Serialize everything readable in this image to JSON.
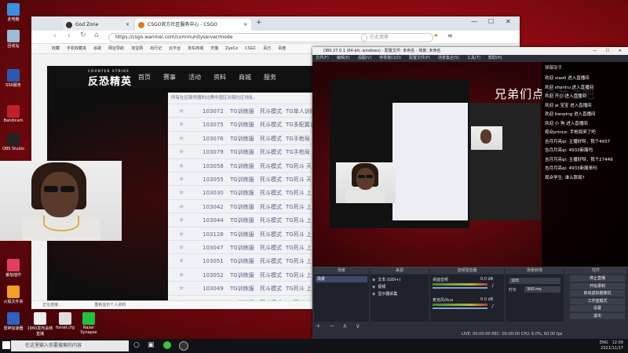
{
  "desktop": {
    "icons": [
      {
        "label": "此电脑",
        "color": "#3a8fe0"
      },
      {
        "label": "回收站",
        "color": "#9bbbd6"
      },
      {
        "label": "SSR服务",
        "color": "#2a5bb0"
      },
      {
        "label": "Bandicam",
        "color": "#c0202a"
      },
      {
        "label": "OBS Studio",
        "color": "#222"
      },
      {
        "label": "番茄插件",
        "color": "#e04060"
      },
      {
        "label": "火狐文件夹",
        "color": "#f0a020"
      },
      {
        "label": "雷神加速器",
        "color": "#3060c0"
      },
      {
        "label": "1960发布会转直播",
        "color": "#eeeeee"
      },
      {
        "label": "forset.cfg",
        "color": "#dddddd"
      },
      {
        "label": "Razer Synapse",
        "color": "#20c040"
      }
    ]
  },
  "browser": {
    "tabs": [
      {
        "label": "God Zone",
        "dot": "#333"
      },
      {
        "label": "CSGO官方社区服务中心 - CSGO",
        "dot": "#e07a20"
      }
    ],
    "new_tab": "+",
    "url": "https://csgo.wanmei.com/communityserver/mode",
    "search_placeholder": "在此搜索",
    "bookmarks": [
      "收藏",
      "手机收藏夹",
      "谷歌",
      "网址导航",
      "淘宝网",
      "出行记",
      "云平台",
      "京东商城",
      "天猫",
      "ZyeCo",
      "CSGC",
      "百万",
      "百度"
    ],
    "site": {
      "logo": "反恐精英",
      "logo_sub": "COUNTER STRIKE",
      "nav": [
        "首页",
        "赛事",
        "活动",
        "资料",
        "商城",
        "服务"
      ]
    },
    "panel": {
      "title": "所有社区服务器的比赛中国区对局社区地址。",
      "rows": [
        {
          "id": "103072",
          "t1": "TG训练服",
          "t2": "死斗模式",
          "t3": "TG单人训练服"
        },
        {
          "id": "103075",
          "t1": "TG训练服",
          "t2": "死斗模式",
          "t3": "TG多配置训练服"
        },
        {
          "id": "103076",
          "t1": "TG训练服",
          "t2": "死斗模式",
          "t3": "TG手枪局"
        },
        {
          "id": "103079",
          "t1": "TG训练服",
          "t2": "死斗模式",
          "t3": "TG手枪局"
        },
        {
          "id": "103058",
          "t1": "TG训练服",
          "t2": "死斗模式",
          "t3": "TG死斗 天"
        },
        {
          "id": "103055",
          "t1": "TG训练服",
          "t2": "死斗模式",
          "t3": "TG死斗 天"
        },
        {
          "id": "103030",
          "t1": "TG训练服",
          "t2": "死斗模式",
          "t3": "TG死斗 上"
        },
        {
          "id": "103042",
          "t1": "TG训练服",
          "t2": "死斗模式",
          "t3": "TG死斗 上"
        },
        {
          "id": "103044",
          "t1": "TG训练服",
          "t2": "死斗模式",
          "t3": "TG死斗 上"
        },
        {
          "id": "103128",
          "t1": "TG训练服",
          "t2": "死斗模式",
          "t3": "TG死斗 上"
        },
        {
          "id": "103047",
          "t1": "TG训练服",
          "t2": "死斗模式",
          "t3": "TG死斗 上"
        },
        {
          "id": "103051",
          "t1": "TG训练服",
          "t2": "死斗模式",
          "t3": "TG死斗 上"
        },
        {
          "id": "103052",
          "t1": "TG训练服",
          "t2": "死斗模式",
          "t3": "TG死斗 上"
        },
        {
          "id": "103049",
          "t1": "TG训练服",
          "t2": "死斗模式",
          "t3": "TG死斗 上"
        },
        {
          "id": "103081",
          "t1": "TG训练服",
          "t2": "死斗模式",
          "t3": "TG死斗 上"
        }
      ]
    },
    "statusbar": "正在连接...",
    "statusbar_right": "重新显示个人资料"
  },
  "obs": {
    "title": "OBS 27.0.1 (64-bit, windows) - 配置文件: 未命名 - 场景: 未命名",
    "menu": [
      "文件(F)",
      "编辑(E)",
      "视图(V)",
      "停靠窗口(D)",
      "配置文件(P)",
      "场景集合(S)",
      "工具(T)",
      "帮助(H)"
    ],
    "overlay_text": "兄弟们点个关注吧",
    "chat_title": "弹幕助手",
    "chat": [
      "欢迎 xiaoli 进入直播间",
      "欢迎 shanhu 进入直播间",
      "欢迎 开心 进入直播间",
      "欢迎 ai 宝宝 进入直播间",
      "欢迎 tianping 进入直播间",
      "欢迎 小 狗 进入直播间",
      "观众prince: 手枪局来了吧",
      "吉月月亮qi: 主播好呀，我个4937",
      "吉月月亮qi: 4933新服吗",
      "吉月月亮qi: 主播好呀，我个27449",
      "吉月月亮qi: 4933新服来吗",
      "观众学生: 谁么那局?"
    ],
    "docks": [
      {
        "label": "场景"
      },
      {
        "label": "来源"
      },
      {
        "label": "音频混音器"
      },
      {
        "label": "场景转场"
      },
      {
        "label": "控件"
      }
    ],
    "scene": "场景",
    "sources": [
      "文本 (GDI+)",
      "视频",
      "显示器采集"
    ],
    "mixer": [
      {
        "label": "桌面音频",
        "db": "0.0 dB"
      },
      {
        "label": "麦克风/Aux",
        "db": "0.0 dB"
      }
    ],
    "transition": {
      "type": "淡出",
      "duration_label": "时长",
      "duration": "300 ms"
    },
    "controls": [
      "停止直播",
      "开始录制",
      "启动虚拟摄像机",
      "工作室模式",
      "设置",
      "退出"
    ],
    "status": "LIVE: 00:00:00   REC: 00:00:00   CPU: 6.0%, 60.00 fps",
    "stream_status": "丢帧 0 (0.0%)"
  },
  "taskbar": {
    "search_placeholder": "在这里输入你要搜索的内容",
    "time": "12:09",
    "date": "2021/11/17",
    "lang": "ENG"
  }
}
